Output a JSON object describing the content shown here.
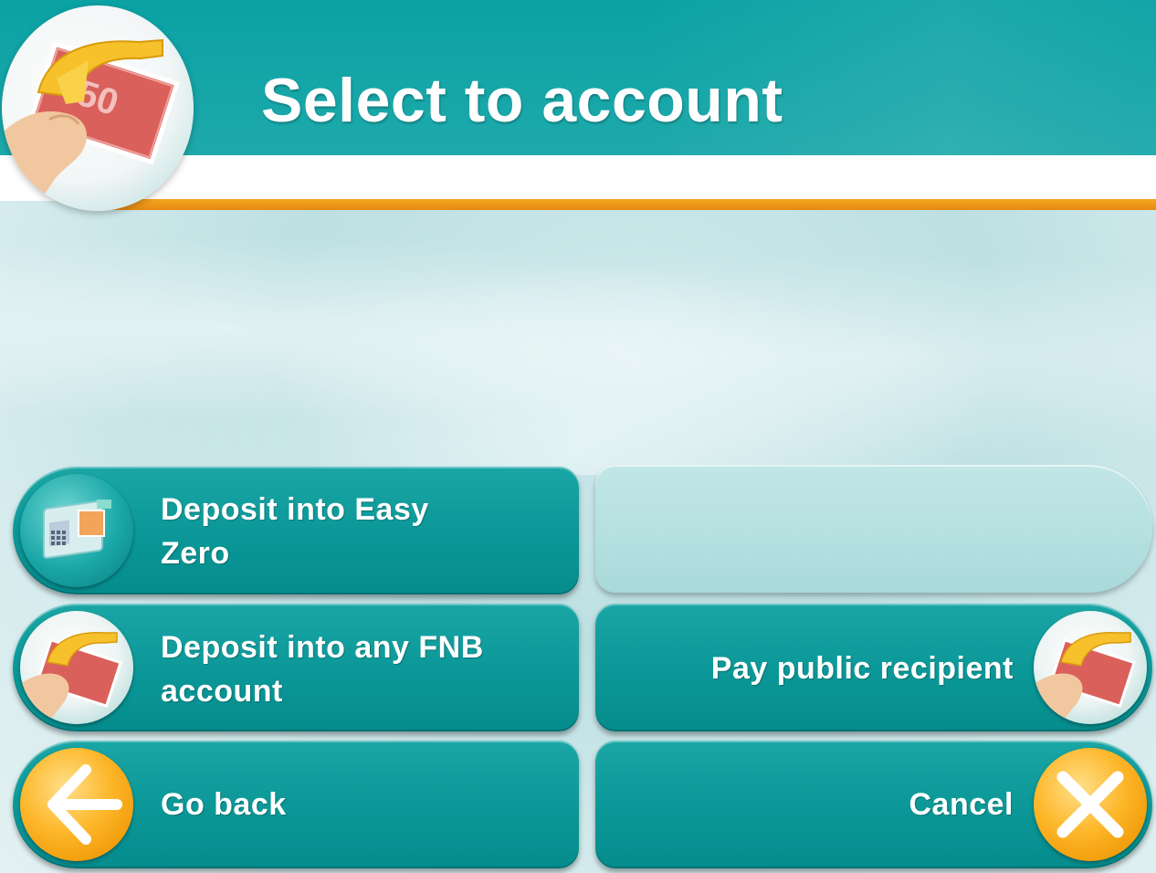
{
  "screen": {
    "title": "Select to account"
  },
  "buttons": {
    "deposit_easy_zero": {
      "label_line1": "Deposit into Easy",
      "label_line2": "Zero",
      "icon": "atm-machine-icon"
    },
    "deposit_any_fnb": {
      "label_line1": "Deposit into any FNB",
      "label_line2": "account",
      "icon": "hand-card-icon"
    },
    "go_back": {
      "label": "Go back",
      "icon": "arrow-left-icon"
    },
    "empty_slot": {
      "label": ""
    },
    "pay_public_recipient": {
      "label": "Pay public recipient",
      "icon": "hand-card-icon"
    },
    "cancel": {
      "label": "Cancel",
      "icon": "close-icon"
    }
  },
  "colors": {
    "primary_teal": "#0b9797",
    "accent_orange": "#f4a51f",
    "disabled_button": "#b4dfe0"
  }
}
